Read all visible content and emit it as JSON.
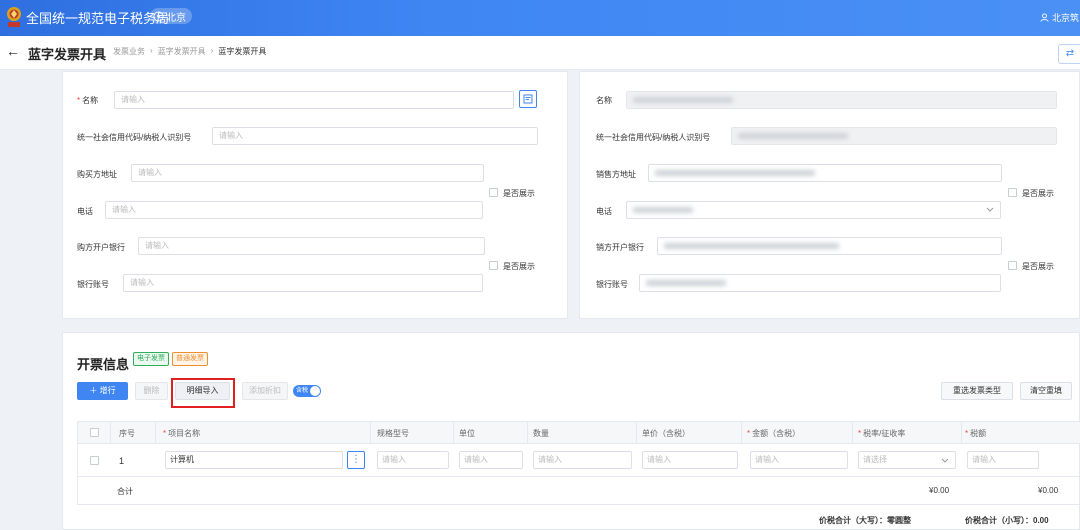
{
  "header": {
    "brand": "全国统一规范电子税务局",
    "region": "北京",
    "user": "北京筑"
  },
  "page": {
    "title": "蓝字发票开具",
    "breadcrumb": [
      "发票业务",
      "蓝字发票开具",
      "蓝字发票开具"
    ],
    "breadcrumb_sep": "›"
  },
  "buyer": {
    "name_label": "名称",
    "name_placeholder": "请输入",
    "taxid_label": "统一社会信用代码/纳税人识别号",
    "taxid_placeholder": "请输入",
    "address_label": "购买方地址",
    "address_placeholder": "请输入",
    "phone_label": "电话",
    "phone_placeholder": "请输入",
    "bank_label": "购方开户银行",
    "bank_placeholder": "请输入",
    "account_label": "银行账号",
    "account_placeholder": "请输入",
    "show_label_1": "是否展示",
    "show_label_2": "是否展示"
  },
  "seller": {
    "name_label": "名称",
    "taxid_label": "统一社会信用代码/纳税人识别号",
    "address_label": "销售方地址",
    "phone_label": "电话",
    "bank_label": "销方开户银行",
    "account_label": "银行账号",
    "show_label_1": "是否展示",
    "show_label_2": "是否展示"
  },
  "invoice": {
    "title": "开票信息",
    "tag_electronic": "电子发票",
    "tag_normal": "普通发票",
    "btn_add": "增行",
    "btn_delete": "删除",
    "btn_detail_import": "明细导入",
    "btn_discount": "添加折扣",
    "toggle_tax": "含税",
    "btn_reselect": "重选发票类型",
    "btn_clear": "清空重填",
    "columns": [
      "序号",
      "项目名称",
      "规格型号",
      "单位",
      "数量",
      "单价（含税）",
      "金额（含税）",
      "税率/征收率",
      "税额"
    ],
    "required_columns": [
      "项目名称",
      "金额（含税）",
      "税率/征收率",
      "税额"
    ],
    "rows": [
      {
        "seq": "1",
        "item": "计算机",
        "spec": "请输入",
        "unit": "请输入",
        "qty": "请输入",
        "price": "请输入",
        "amount": "请输入",
        "rate": "请选择",
        "tax": "请输入"
      }
    ],
    "subtotal_label": "合计",
    "subtotal_amount": "¥0.00",
    "subtotal_tax": "¥0.00",
    "total_upper_label": "价税合计（大写）：",
    "total_upper_value": "零圆整",
    "total_lower_label": "价税合计（小写）：",
    "total_lower_value": "0.00"
  },
  "colors": {
    "primary": "#3f86f3",
    "required": "#f0483e",
    "highlight_box": "#e02020",
    "tag_green": "#2fae5b",
    "tag_orange": "#f0902d"
  }
}
